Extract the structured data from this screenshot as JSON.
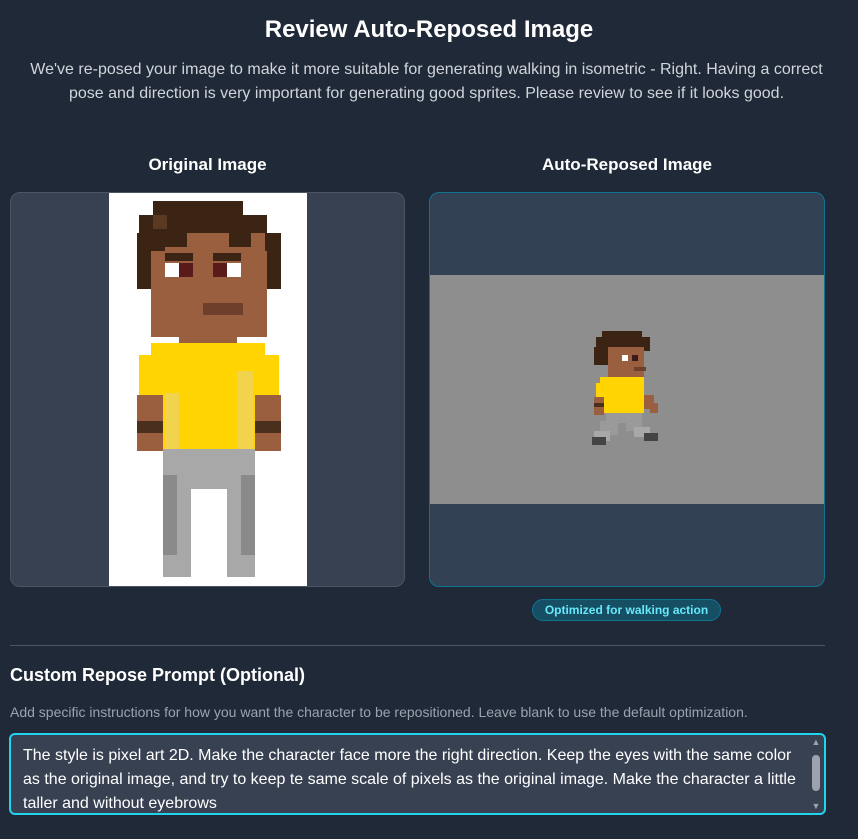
{
  "header": {
    "title": "Review Auto-Reposed Image",
    "description": "We've re-posed your image to make it more suitable for generating walking in isometric - Right. Having a correct pose and direction is very important for generating good sprites. Please review to see if it looks good."
  },
  "original": {
    "label": "Original Image"
  },
  "reposed": {
    "label": "Auto-Reposed Image",
    "badge": "Optimized for walking action"
  },
  "custom_prompt": {
    "title": "Custom Repose Prompt (Optional)",
    "helper": "Add specific instructions for how you want the character to be repositioned. Leave blank to use the default optimization.",
    "value": "The style is pixel art 2D. Make the character face more the right direction. Keep the eyes with the same color as the original image, and try to keep te same scale of pixels as the original image. Make the character a little taller and without eyebrows"
  },
  "colors": {
    "background": "#1f2937",
    "accent": "#22d3ee",
    "badge_text": "#67e8f9",
    "hair": "#3b2414",
    "skin": "#9a5f3f",
    "shirt": "#ffd400",
    "pants": "#a8a8a8"
  }
}
